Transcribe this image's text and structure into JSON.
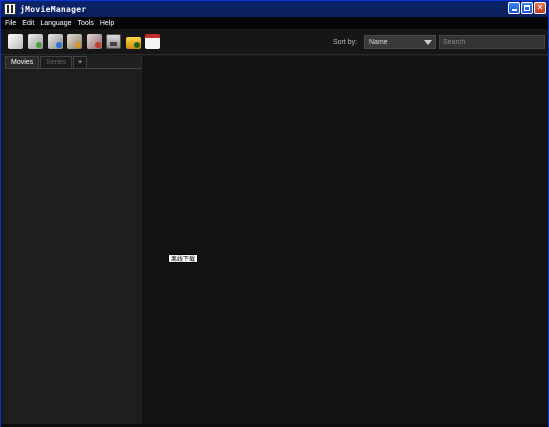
{
  "window": {
    "title": "jMovieManager"
  },
  "menu": {
    "items": [
      "File",
      "Edit",
      "Language",
      "Tools",
      "Help"
    ]
  },
  "toolbar": {
    "icons": [
      "new-icon",
      "add-series-icon",
      "add-episode-icon",
      "edit-icon",
      "remove-icon",
      "save-icon",
      "open-folder-icon",
      "calendar-icon"
    ],
    "sort_label": "Sort by:",
    "sort_value": "Name",
    "search_placeholder": "Search"
  },
  "sidebar": {
    "tabs": [
      {
        "label": "Movies",
        "active": true
      },
      {
        "label": "Series",
        "active": false
      },
      {
        "label": "+",
        "active": false
      }
    ]
  },
  "tooltip": {
    "text": "离线下载"
  },
  "colors": {
    "background": "#121212",
    "sidebar": "#202020",
    "titlebar": "#0a246a"
  }
}
